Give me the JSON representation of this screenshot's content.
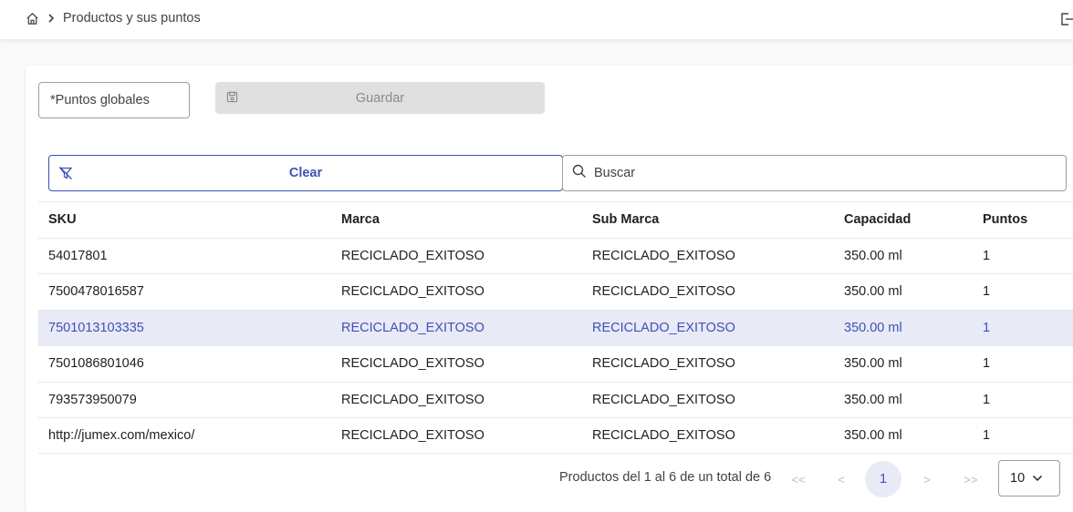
{
  "breadcrumb": {
    "current": "Productos y sus puntos"
  },
  "form": {
    "points_placeholder": "*Puntos globales",
    "save_label": "Guardar"
  },
  "filters": {
    "clear_label": "Clear",
    "search_placeholder": "Buscar"
  },
  "table": {
    "columns": [
      "SKU",
      "Marca",
      "Sub Marca",
      "Capacidad",
      "Puntos"
    ],
    "rows": [
      [
        "54017801",
        "RECICLADO_EXITOSO",
        "RECICLADO_EXITOSO",
        "350.00 ml",
        "1"
      ],
      [
        "7500478016587",
        "RECICLADO_EXITOSO",
        "RECICLADO_EXITOSO",
        "350.00 ml",
        "1"
      ],
      [
        "7501013103335",
        "RECICLADO_EXITOSO",
        "RECICLADO_EXITOSO",
        "350.00 ml",
        "1"
      ],
      [
        "7501086801046",
        "RECICLADO_EXITOSO",
        "RECICLADO_EXITOSO",
        "350.00 ml",
        "1"
      ],
      [
        "793573950079",
        "RECICLADO_EXITOSO",
        "RECICLADO_EXITOSO",
        "350.00 ml",
        "1"
      ],
      [
        "http://jumex.com/mexico/",
        "RECICLADO_EXITOSO",
        "RECICLADO_EXITOSO",
        "350.00 ml",
        "1"
      ]
    ],
    "selected_row": 2
  },
  "pagination": {
    "range_text": "Productos del 1 al 6 de un total de 6",
    "first": "<<",
    "prev": "<",
    "current_page": "1",
    "next": ">",
    "last": ">>",
    "page_size": "10"
  },
  "colors": {
    "accent": "#3f51b5",
    "selected_bg": "#e8eaf6",
    "disabled_bg": "#e0e0e0"
  }
}
